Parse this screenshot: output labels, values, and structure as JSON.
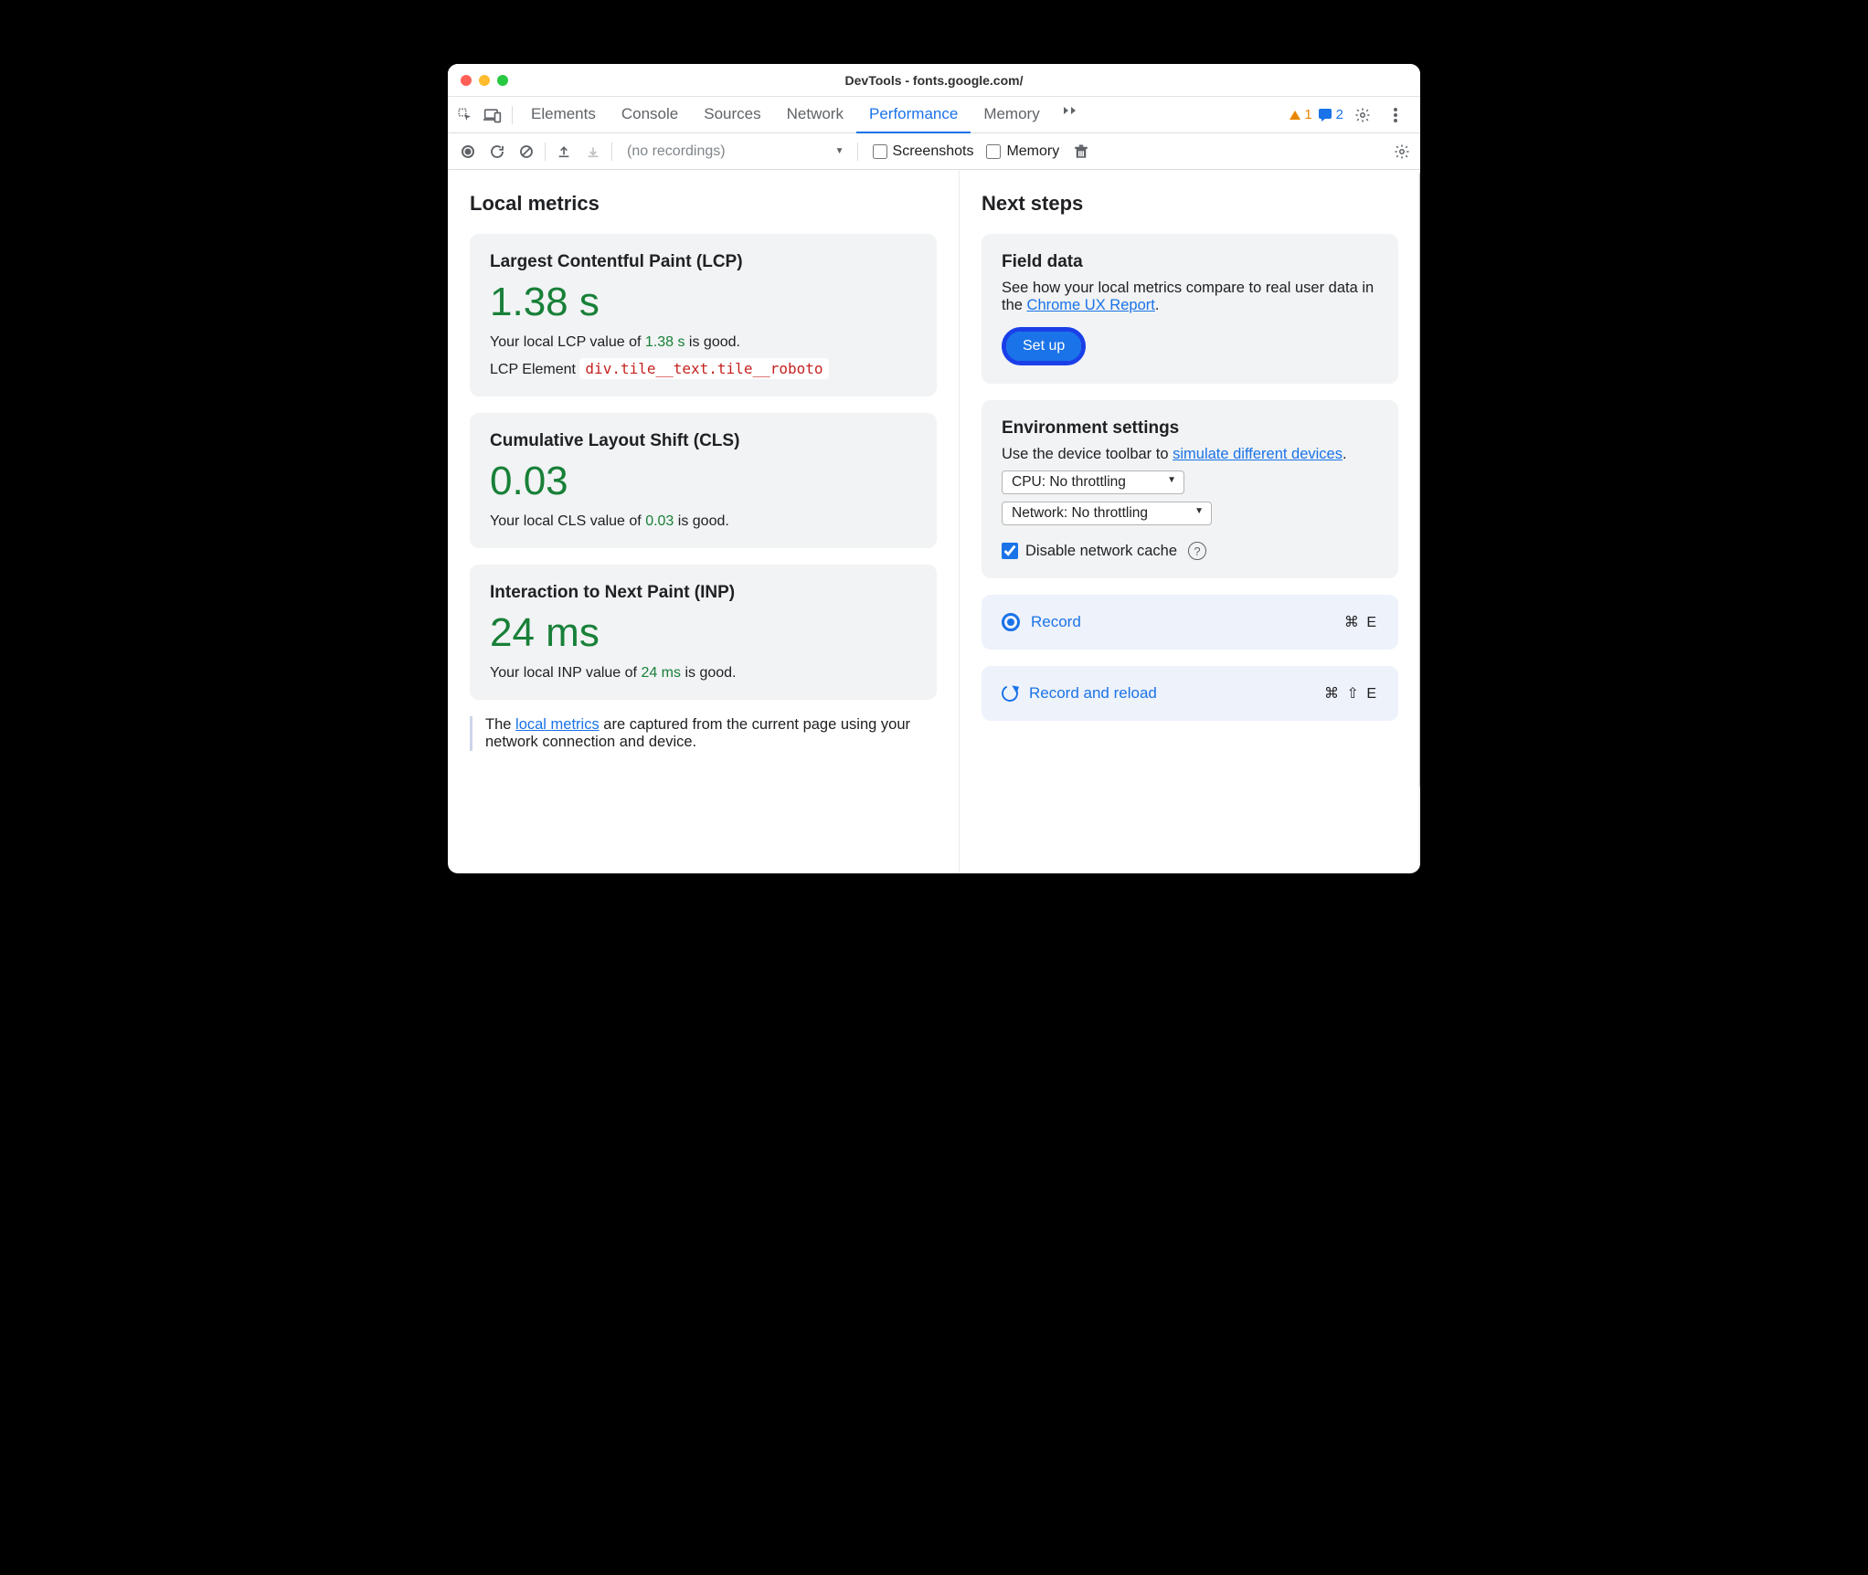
{
  "window_title": "DevTools - fonts.google.com/",
  "tabs": [
    "Elements",
    "Console",
    "Sources",
    "Network",
    "Performance",
    "Memory"
  ],
  "active_tab_index": 4,
  "badges": {
    "warn_count": "1",
    "info_count": "2"
  },
  "subtoolbar": {
    "no_recordings": "(no recordings)",
    "screenshots": "Screenshots",
    "memory": "Memory"
  },
  "left": {
    "heading": "Local metrics",
    "lcp": {
      "title": "Largest Contentful Paint (LCP)",
      "value": "1.38 s",
      "desc_pre": "Your local LCP value of ",
      "desc_val": "1.38 s",
      "desc_post": " is good.",
      "el_label": "LCP Element ",
      "el_selector": "div.tile__text.tile__roboto"
    },
    "cls": {
      "title": "Cumulative Layout Shift (CLS)",
      "value": "0.03",
      "desc_pre": "Your local CLS value of ",
      "desc_val": "0.03",
      "desc_post": " is good."
    },
    "inp": {
      "title": "Interaction to Next Paint (INP)",
      "value": "24 ms",
      "desc_pre": "Your local INP value of ",
      "desc_val": "24 ms",
      "desc_post": " is good."
    },
    "info_pre": "The ",
    "info_link": "local metrics",
    "info_post": " are captured from the current page using your network connection and device."
  },
  "right": {
    "heading": "Next steps",
    "field": {
      "title": "Field data",
      "desc_pre": "See how your local metrics compare to real user data in the ",
      "desc_link": "Chrome UX Report",
      "desc_post": ".",
      "button": "Set up"
    },
    "env": {
      "title": "Environment settings",
      "desc_pre": "Use the device toolbar to ",
      "desc_link": "simulate different devices",
      "desc_post": ".",
      "cpu": "CPU: No throttling",
      "net": "Network: No throttling",
      "disable_cache": "Disable network cache"
    },
    "record": {
      "label": "Record",
      "shortcut": "⌘ E"
    },
    "reload": {
      "label": "Record and reload",
      "shortcut": "⌘ ⇧ E"
    }
  }
}
